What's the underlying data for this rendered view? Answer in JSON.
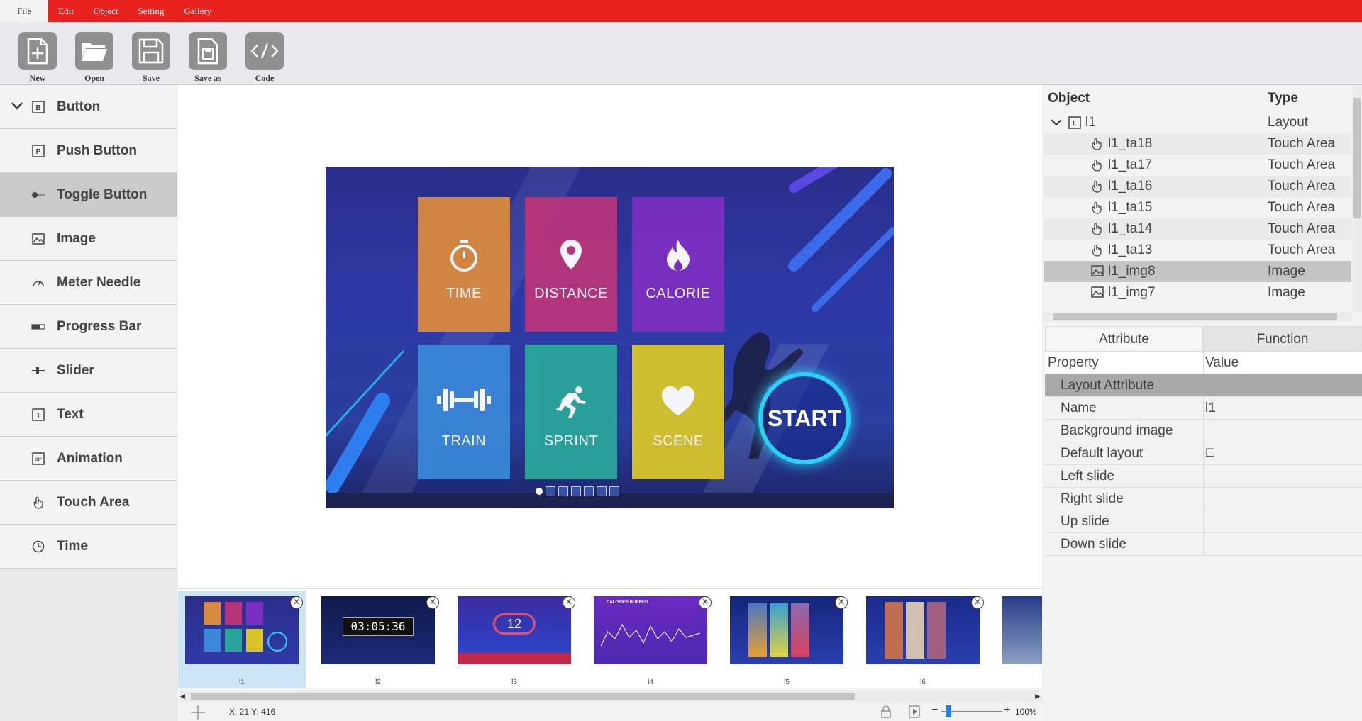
{
  "menu": {
    "items": [
      "File",
      "Edit",
      "Object",
      "Setting",
      "Gallery"
    ],
    "active": "File"
  },
  "toolbar": {
    "buttons": [
      {
        "label": "New",
        "icon": "new-file-icon"
      },
      {
        "label": "Open",
        "icon": "folder-open-icon"
      },
      {
        "label": "Save",
        "icon": "save-icon"
      },
      {
        "label": "Save as",
        "icon": "save-as-icon"
      },
      {
        "label": "Code",
        "icon": "code-icon"
      }
    ]
  },
  "widgets": {
    "root": {
      "label": "Button",
      "icon_text": "B"
    },
    "items": [
      {
        "label": "Push Button",
        "icon": "push-button-icon",
        "icon_text": "P"
      },
      {
        "label": "Toggle Button",
        "icon": "toggle-button-icon",
        "icon_text": ""
      },
      {
        "label": "Image",
        "icon": "image-icon",
        "icon_text": ""
      },
      {
        "label": "Meter Needle",
        "icon": "meter-needle-icon",
        "icon_text": ""
      },
      {
        "label": "Progress Bar",
        "icon": "progress-bar-icon",
        "icon_text": ""
      },
      {
        "label": "Slider",
        "icon": "slider-icon",
        "icon_text": ""
      },
      {
        "label": "Text",
        "icon": "text-icon",
        "icon_text": "T"
      },
      {
        "label": "Animation",
        "icon": "animation-icon",
        "icon_text": "GIF"
      },
      {
        "label": "Touch Area",
        "icon": "touch-area-icon",
        "icon_text": ""
      },
      {
        "label": "Time",
        "icon": "time-icon",
        "icon_text": ""
      }
    ],
    "selected": "Toggle Button"
  },
  "design": {
    "tiles": [
      {
        "label": "TIME",
        "icon": "stopwatch-icon",
        "color": "#d98a3f"
      },
      {
        "label": "DISTANCE",
        "icon": "map-pin-icon",
        "color": "#b8357a"
      },
      {
        "label": "CALORIE",
        "icon": "flame-icon",
        "color": "#7b2fc0"
      },
      {
        "label": "TRAIN",
        "icon": "dumbbell-icon",
        "color": "#3a86d8"
      },
      {
        "label": "SPRINT",
        "icon": "runner-icon",
        "color": "#2aa59a"
      },
      {
        "label": "SCENE",
        "icon": "heart-icon",
        "color": "#d8c52a"
      }
    ],
    "start_label": "START",
    "page_dots": 7
  },
  "thumbnails": {
    "items": [
      {
        "caption": "l1",
        "text": ""
      },
      {
        "caption": "l2",
        "text": "03:05:36"
      },
      {
        "caption": "l3",
        "text": "12"
      },
      {
        "caption": "l4",
        "text": "CALORIES BURNED"
      },
      {
        "caption": "l5",
        "text": ""
      },
      {
        "caption": "l6",
        "text": ""
      }
    ],
    "close_glyph": "✕"
  },
  "status": {
    "coords": "X: 21 Y: 416",
    "zoom": "100%",
    "zoom_minus": "−",
    "zoom_plus": "+"
  },
  "objects": {
    "headers": {
      "object": "Object",
      "type": "Type"
    },
    "rows": [
      {
        "name": "l1",
        "type": "Layout",
        "icon": "layout-icon",
        "icon_text": "L"
      },
      {
        "name": "l1_ta18",
        "type": "Touch Area",
        "icon": "touch-area-icon"
      },
      {
        "name": "l1_ta17",
        "type": "Touch Area",
        "icon": "touch-area-icon"
      },
      {
        "name": "l1_ta16",
        "type": "Touch Area",
        "icon": "touch-area-icon"
      },
      {
        "name": "l1_ta15",
        "type": "Touch Area",
        "icon": "touch-area-icon"
      },
      {
        "name": "l1_ta14",
        "type": "Touch Area",
        "icon": "touch-area-icon"
      },
      {
        "name": "l1_ta13",
        "type": "Touch Area",
        "icon": "touch-area-icon"
      },
      {
        "name": "l1_img8",
        "type": "Image",
        "icon": "image-icon"
      },
      {
        "name": "l1_img7",
        "type": "Image",
        "icon": "image-icon"
      }
    ],
    "selected": "l1_img8"
  },
  "tabs": {
    "attribute": "Attribute",
    "function": "Function"
  },
  "properties": {
    "headers": {
      "property": "Property",
      "value": "Value"
    },
    "section": "Layout Attribute",
    "rows": [
      {
        "name": "Name",
        "value": "l1"
      },
      {
        "name": "Background image",
        "value": ""
      },
      {
        "name": "Default layout",
        "value": "☐"
      },
      {
        "name": "Left slide",
        "value": ""
      },
      {
        "name": "Right slide",
        "value": ""
      },
      {
        "name": "Up slide",
        "value": ""
      },
      {
        "name": "Down slide",
        "value": ""
      }
    ]
  }
}
